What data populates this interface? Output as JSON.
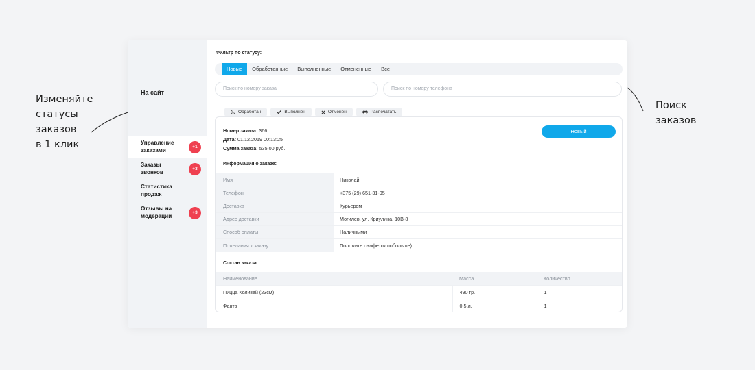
{
  "callouts": {
    "left": [
      "Изменяйте",
      "статусы",
      "заказов",
      "в 1 клик"
    ],
    "right": [
      "Поиск",
      "заказов"
    ]
  },
  "sidebar": {
    "site_link": "На сайт",
    "items": [
      {
        "label": "Управление заказами",
        "badge": "+1",
        "active": true
      },
      {
        "label": "Заказы звонков",
        "badge": "+3"
      },
      {
        "label": "Статистика продаж",
        "badge": ""
      },
      {
        "label": "Отзывы на модерации",
        "badge": "+3"
      }
    ]
  },
  "filter": {
    "label": "Фильтр по статусу:",
    "tabs": [
      "Новые",
      "Обработанные",
      "Выполненные",
      "Отмененные",
      "Все"
    ],
    "active_tab": "Новые"
  },
  "search": {
    "order_placeholder": "Поиск по номеру заказа",
    "phone_placeholder": "Поиск по номеру телефона"
  },
  "actions": [
    {
      "label": "Обработан",
      "icon": "spinner-icon"
    },
    {
      "label": "Выполнен",
      "icon": "check-icon"
    },
    {
      "label": "Отменен",
      "icon": "cross-icon"
    },
    {
      "label": "Распечатать",
      "icon": "printer-icon"
    }
  ],
  "order": {
    "number_label": "Номер заказа:",
    "number": "366",
    "date_label": "Дата:",
    "date": "01.12.2019 00:13:25",
    "sum_label": "Сумма заказа:",
    "sum": "535.00 руб.",
    "status": "Новый",
    "info_title": "Информация о заказе:",
    "info": [
      {
        "key": "Имя",
        "value": "Николай"
      },
      {
        "key": "Телефон",
        "value": "+375 (29) 651-31-95"
      },
      {
        "key": "Доставка",
        "value": "Курьером"
      },
      {
        "key": "Адрес доставки",
        "value": "Могилев, ул. Криулина, 10В-8"
      },
      {
        "key": "Способ оплаты",
        "value": "Наличными"
      },
      {
        "key": "Пожелания к заказу",
        "value": "Положите салфеток побольше)"
      }
    ],
    "items_title": "Состав заказа:",
    "items_columns": [
      "Наименование",
      "Масса",
      "Количество"
    ],
    "items": [
      {
        "name": "Пицца Колизей (23см)",
        "mass": "490 гр.",
        "qty": "1"
      },
      {
        "name": "Фанта",
        "mass": "0.5 л.",
        "qty": "1"
      }
    ]
  },
  "colors": {
    "accent": "#10a8ea",
    "badge": "#ef4050",
    "sidebar_bg": "#f1f3f6"
  }
}
